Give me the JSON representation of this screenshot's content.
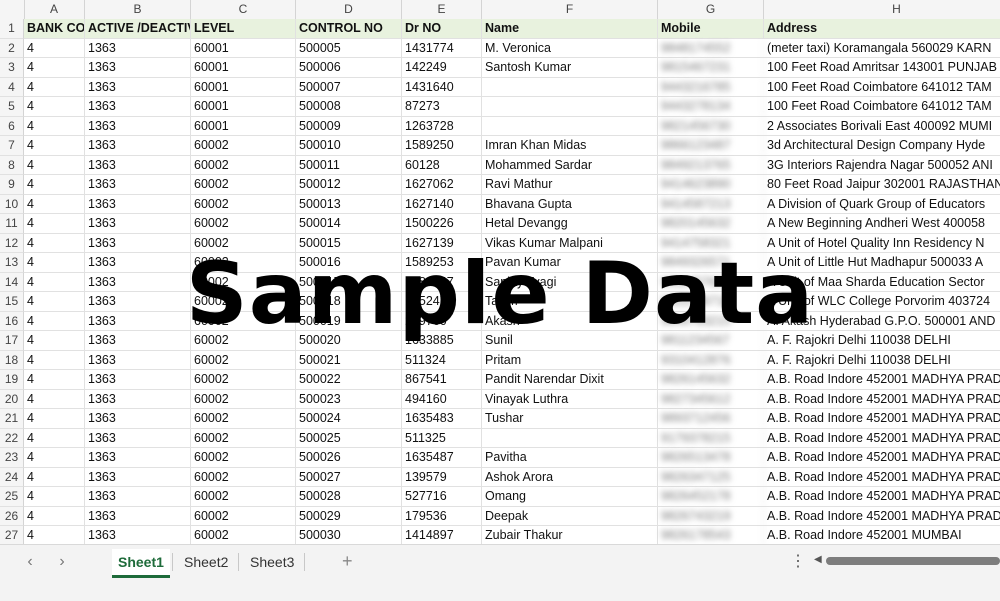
{
  "columns": [
    "A",
    "B",
    "C",
    "D",
    "E",
    "F",
    "G",
    "H"
  ],
  "header": [
    "BANK COI",
    "ACTIVE /DEACTIV",
    "LEVEL",
    "CONTROL NO",
    "Dr NO",
    "Name",
    "Mobile",
    "Address"
  ],
  "rows": [
    [
      "4",
      "1363",
      "60001",
      "500005",
      "1431774",
      "M. Veronica",
      "9848174552",
      "(meter taxi) Koramangala 560029 KARN"
    ],
    [
      "4",
      "1363",
      "60001",
      "500006",
      "142249",
      "Santosh Kumar",
      "9815467231",
      "100 Feet Road Amritsar 143001 PUNJAB"
    ],
    [
      "4",
      "1363",
      "60001",
      "500007",
      "1431640",
      "",
      "9443216785",
      "100 Feet Road Coimbatore 641012 TAM"
    ],
    [
      "4",
      "1363",
      "60001",
      "500008",
      "87273",
      "",
      "9443278134",
      "100 Feet Road Coimbatore 641012 TAM"
    ],
    [
      "4",
      "1363",
      "60001",
      "500009",
      "1263728",
      "",
      "9821456730",
      "2 Associates Borivali East 400092 MUMI"
    ],
    [
      "4",
      "1363",
      "60002",
      "500010",
      "1589250",
      "Imran Khan Midas",
      "9866123487",
      "3d Architectural Design Company Hyde"
    ],
    [
      "4",
      "1363",
      "60002",
      "500011",
      "60128",
      "Mohammed Sardar",
      "9849213765",
      "3G Interiors Rajendra Nagar 500052 ANI"
    ],
    [
      "4",
      "1363",
      "60002",
      "500012",
      "1627062",
      "Ravi Mathur",
      "9414623890",
      "80 Feet Road Jaipur 302001 RAJASTHAN"
    ],
    [
      "4",
      "1363",
      "60002",
      "500013",
      "1627140",
      "Bhavana Gupta",
      "9414587213",
      "A Division of Quark Group of Educators"
    ],
    [
      "4",
      "1363",
      "60002",
      "500014",
      "1500226",
      "Hetal Devangg",
      "9820145632",
      "A New Beginning Andheri West 400058"
    ],
    [
      "4",
      "1363",
      "60002",
      "500015",
      "1627139",
      "Vikas Kumar Malpani",
      "9414758321",
      "A Unit of Hotel Quality Inn Residency N"
    ],
    [
      "4",
      "1363",
      "60002",
      "500016",
      "1589253",
      "Pavan Kumar",
      "9849326571",
      "A Unit of Little Hut Madhapur 500033 A"
    ],
    [
      "4",
      "1363",
      "60002",
      "500017",
      "1589247",
      "Sanjay Tyagi",
      "9811457623",
      "A Unit of Maa Sharda Education Sector"
    ],
    [
      "4",
      "1363",
      "60002",
      "500018",
      "1452479",
      "Tazim",
      "9822356710",
      "A Unit of WLC College Porvorim 403724"
    ],
    [
      "4",
      "1363",
      "60002",
      "500019",
      "269760",
      "Akash",
      "9849763215",
      "A. Akash Hyderabad G.P.O. 500001 AND"
    ],
    [
      "4",
      "1363",
      "60002",
      "500020",
      "1633885",
      "Sunil",
      "9811234567",
      "A. F. Rajokri Delhi 110038 DELHI"
    ],
    [
      "4",
      "1363",
      "60002",
      "500021",
      "511324",
      "Pritam",
      "9310412876",
      "A. F. Rajokri Delhi 110038 DELHI"
    ],
    [
      "4",
      "1363",
      "60002",
      "500022",
      "867541",
      "Pandit Narendar Dixit",
      "9826145632",
      "A.B. Road Indore 452001 MADHYA PRAD"
    ],
    [
      "4",
      "1363",
      "60002",
      "500023",
      "494160",
      "Vinayak Luthra",
      "9827345612",
      "A.B. Road Indore 452001 MADHYA PRAD"
    ],
    [
      "4",
      "1363",
      "60002",
      "500024",
      "1635483",
      "Tushar",
      "9893712456",
      "A.B. Road Indore 452001 MADHYA PRAD"
    ],
    [
      "4",
      "1363",
      "60002",
      "500025",
      "511325",
      "",
      "9179378215",
      "A.B. Road Indore 452001 MADHYA PRAD"
    ],
    [
      "4",
      "1363",
      "60002",
      "500026",
      "1635487",
      "Pavitha",
      "9826513478",
      "A.B. Road Indore 452001 MADHYA PRAD"
    ],
    [
      "4",
      "1363",
      "60002",
      "500027",
      "139579",
      "Ashok Arora",
      "9826347125",
      "A.B. Road Indore 452001 MADHYA PRAD"
    ],
    [
      "4",
      "1363",
      "60002",
      "500028",
      "527716",
      "Omang",
      "9826452178",
      "A.B. Road Indore 452001 MADHYA PRAD"
    ],
    [
      "4",
      "1363",
      "60002",
      "500029",
      "179536",
      "Deepak",
      "9826743219",
      "A.B. Road Indore 452001 MADHYA PRAD"
    ],
    [
      "4",
      "1363",
      "60002",
      "500030",
      "1414897",
      "Zubair Thakur",
      "9826178543",
      "A.B. Road Indore 452001 MUMBAI"
    ]
  ],
  "watermark": "Sample Data",
  "tabs": [
    "Sheet1",
    "Sheet2",
    "Sheet3"
  ],
  "active_tab": "Sheet1",
  "icons": {
    "prev": "chevron-left-icon",
    "next": "chevron-right-icon",
    "add": "plus-icon",
    "menu": "vertical-dots-icon"
  },
  "colors": {
    "header_fill": "#e8f2de",
    "active_tab": "#1e6b3a"
  }
}
